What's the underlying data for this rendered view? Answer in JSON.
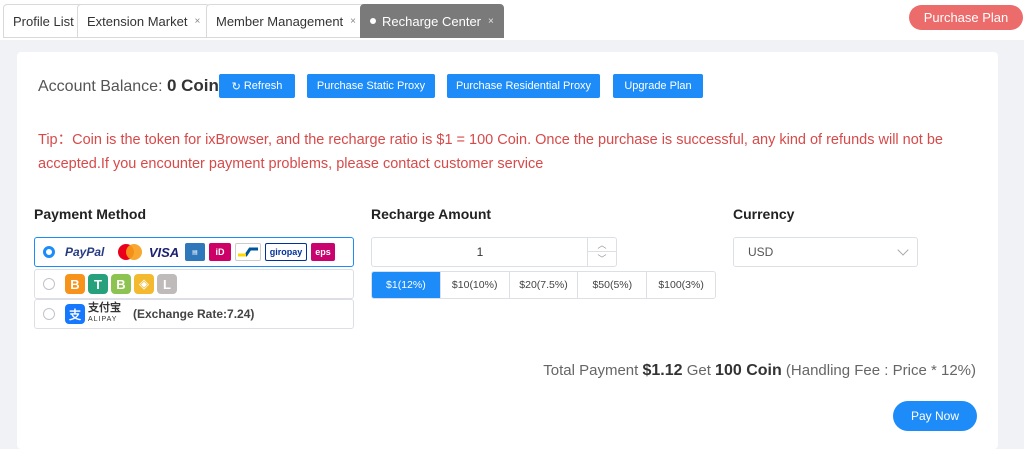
{
  "tabs": [
    {
      "label": "Profile List",
      "closable": false,
      "active": false
    },
    {
      "label": "Extension Market",
      "closable": true,
      "active": false
    },
    {
      "label": "Member Management",
      "closable": true,
      "active": false
    },
    {
      "label": "Recharge Center",
      "closable": true,
      "active": true
    }
  ],
  "tab_close_glyph": "×",
  "header": {
    "purchase_plan_label": "Purchase Plan"
  },
  "balance": {
    "label": "Account Balance: ",
    "value": "0 Coin"
  },
  "toolbar": {
    "refresh_label": "Refresh",
    "static_proxy_label": "Purchase Static Proxy",
    "residential_proxy_label": "Purchase Residential Proxy",
    "upgrade_label": "Upgrade Plan"
  },
  "tip": "Tip：Coin is the token for ixBrowser, and the recharge ratio is $1 = 100 Coin. Once the purchase is successful, any kind of refunds will not be accepted.If you encounter payment problems, please contact customer service",
  "payment": {
    "title": "Payment Method",
    "methods": [
      {
        "id": "card",
        "selected": true,
        "logos": [
          "PayPal",
          "VISA",
          "iD",
          "giropay",
          "eps"
        ]
      },
      {
        "id": "crypto",
        "selected": false,
        "logos": [
          "B",
          "T",
          "B",
          "L"
        ]
      },
      {
        "id": "alipay",
        "selected": false,
        "logos": [
          "支付宝",
          "ALIPAY"
        ],
        "rate": "(Exchange Rate:7.24)"
      }
    ]
  },
  "recharge": {
    "title": "Recharge Amount",
    "value": "1",
    "options": [
      {
        "label": "$1(12%)",
        "active": true
      },
      {
        "label": "$10(10%)",
        "active": false
      },
      {
        "label": "$20(7.5%)",
        "active": false
      },
      {
        "label": "$50(5%)",
        "active": false
      },
      {
        "label": "$100(3%)",
        "active": false
      }
    ]
  },
  "currency": {
    "title": "Currency",
    "selected": "USD"
  },
  "total": {
    "prefix": "Total Payment ",
    "amount": "$1.12",
    "get_text": " Get ",
    "coins": "100 Coin",
    "fee_note": " (Handling Fee : Price * 12%)"
  },
  "pay_now_label": "Pay Now",
  "colors": {
    "primary": "#1d8cf8",
    "danger": "#d74a4a",
    "purchase_plan": "#ec6b6b",
    "active_tab": "#7a7a7a"
  }
}
